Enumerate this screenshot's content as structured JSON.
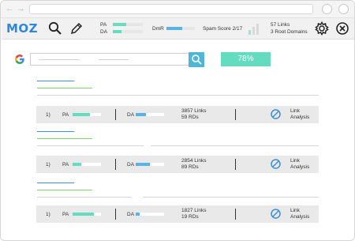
{
  "colors": {
    "brand": "#2f87d9",
    "teal": "#64dcc0",
    "blue_bar": "#5ab3e0",
    "search_button": "#4fb6d6",
    "green_line": "#7ed66a",
    "blue_line": "#3f8fd6"
  },
  "toolbar": {
    "logo": "MOZ",
    "pa_label": "PA",
    "da_label": "DA",
    "dmr_label": "DmR",
    "spam_label": "Spam Score 2/17",
    "links_label": "57 Links",
    "root_domains_label": "3 Root Domains",
    "pa_level": 0.45,
    "da_level": 0.3,
    "dmr_level": 0.55,
    "icons": [
      "search-icon",
      "pencil-icon",
      "gear-icon",
      "close-icon"
    ]
  },
  "search": {
    "engine_icon": "google-g-icon",
    "search_icon": "search-icon",
    "score": "78%"
  },
  "results": [
    {
      "rank": "1)",
      "pa_label": "PA",
      "da_label": "DA",
      "pa_level": 0.6,
      "da_level": 0.35,
      "links": "3857 Links",
      "rds": "59 RDs",
      "action": "Link\nAnalysis",
      "action_line1": "Link",
      "action_line2": "Analysis"
    },
    {
      "rank": "1)",
      "pa_label": "PA",
      "da_label": "DA",
      "pa_level": 0.3,
      "da_level": 0.5,
      "links": "2854 Links",
      "rds": "89 RDs",
      "action_line1": "Link",
      "action_line2": "Analysis"
    },
    {
      "rank": "1)",
      "pa_label": "PA",
      "da_label": "DA",
      "pa_level": 0.75,
      "da_level": 0.15,
      "links": "1827 Links",
      "rds": "19 RDs",
      "action_line1": "Link",
      "action_line2": "Analysis"
    }
  ]
}
